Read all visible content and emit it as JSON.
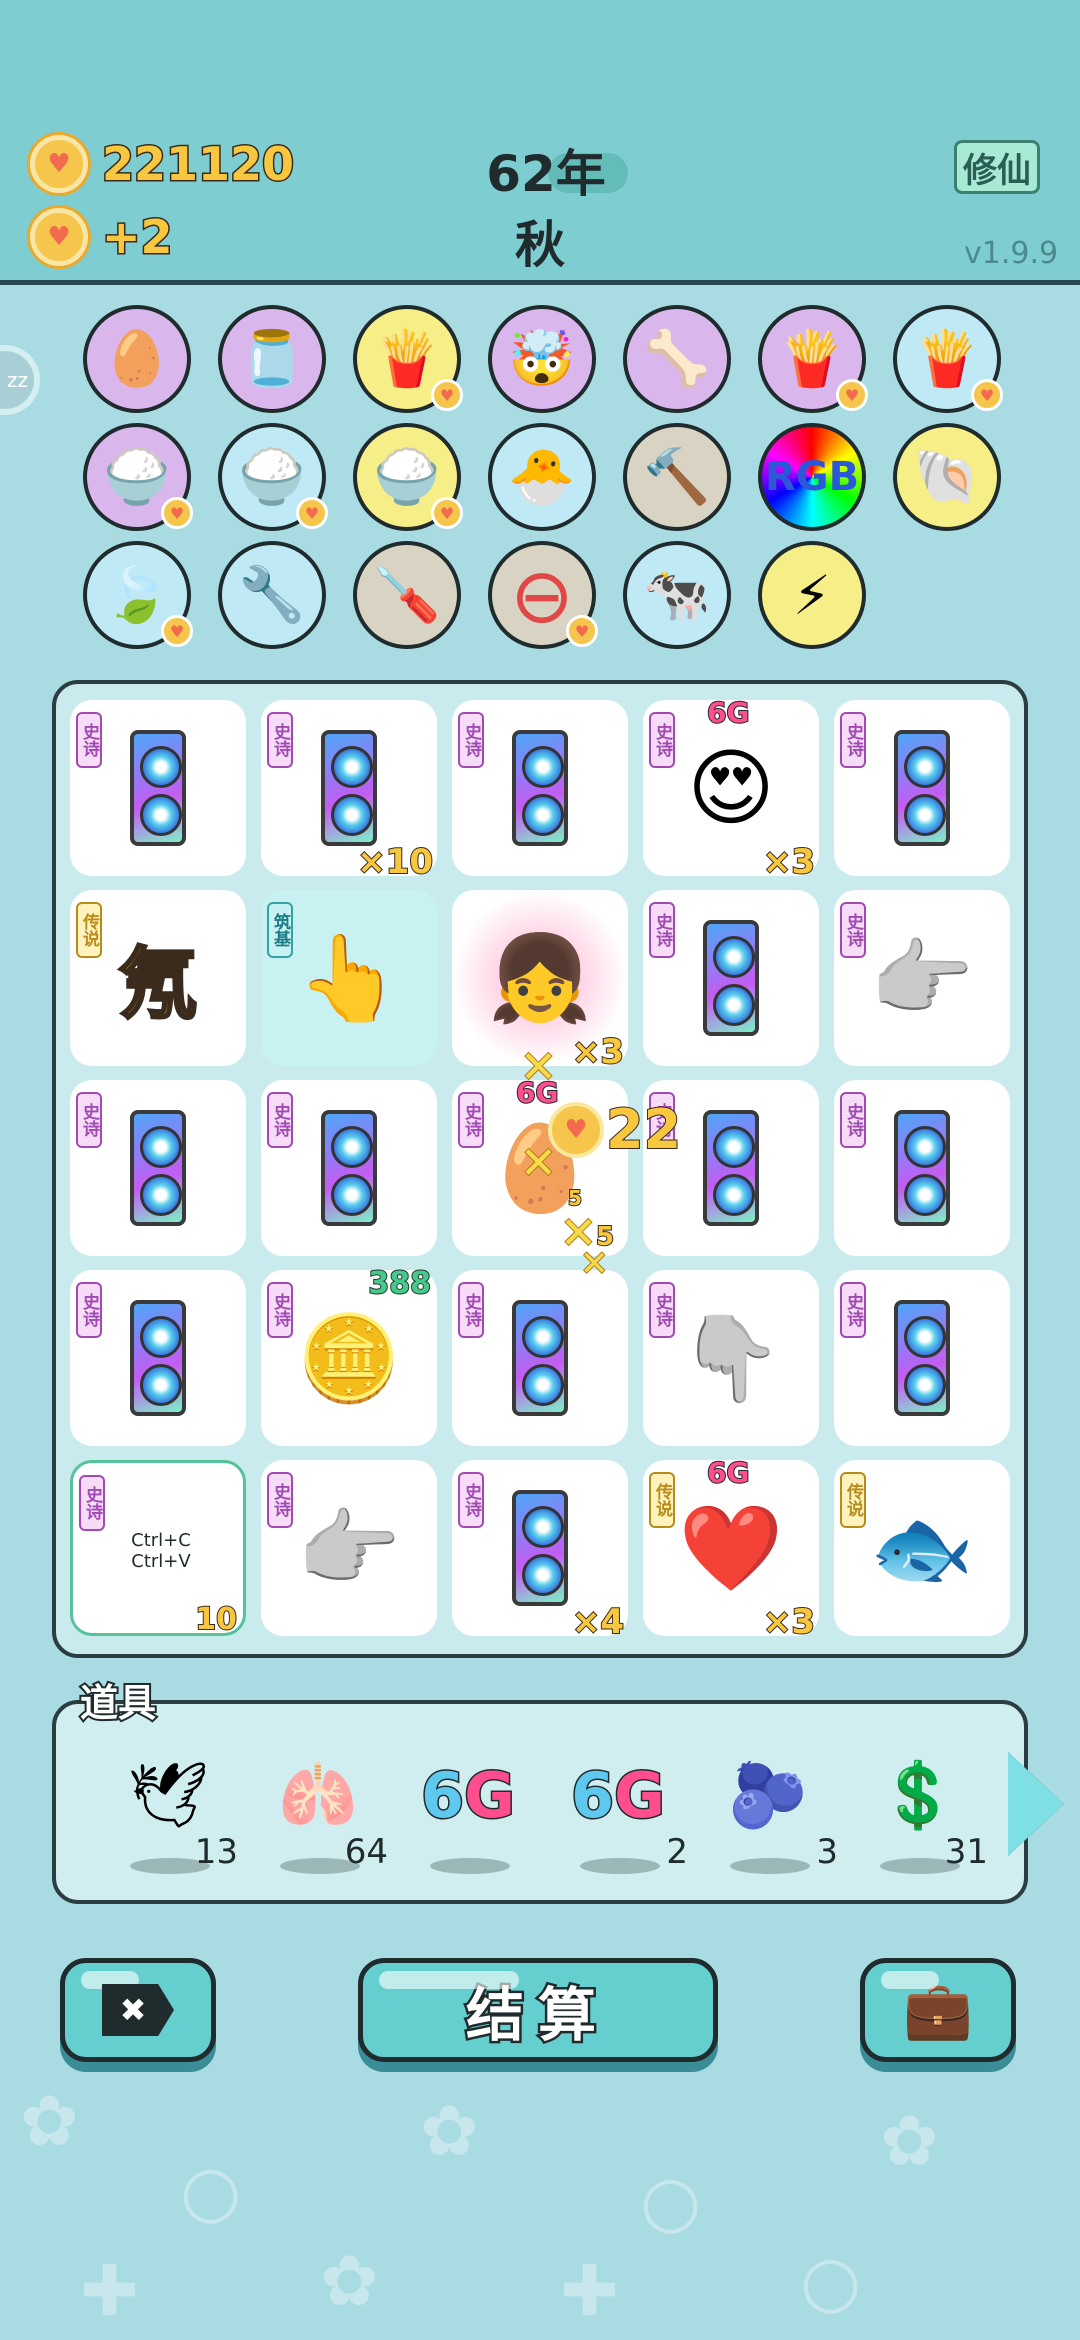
{
  "header": {
    "coins": "221120",
    "income": "+2",
    "year": "62年",
    "season": "秋",
    "mode_label": "修仙",
    "version": "v1.9.9",
    "side_bubble": "zz"
  },
  "items_row": [
    {
      "name": "egg-icon",
      "glyph": "🥚",
      "bg": "#d9b7ec",
      "heart": false
    },
    {
      "name": "jar-icon",
      "glyph": "🫙",
      "bg": "#d9b7ec",
      "heart": false
    },
    {
      "name": "fries-icon",
      "glyph": "🍟",
      "bg": "#f6ee86",
      "heart": true
    },
    {
      "name": "math-head-icon",
      "glyph": "🤯",
      "bg": "#d9b7ec",
      "heart": false
    },
    {
      "name": "dog-bowl-icon",
      "glyph": "🦴",
      "bg": "#d9b7ec",
      "heart": false
    },
    {
      "name": "fries-icon",
      "glyph": "🍟",
      "bg": "#d9b7ec",
      "heart": true
    },
    {
      "name": "fries-icon",
      "glyph": "🍟",
      "bg": "#bfe9f5",
      "heart": true
    },
    {
      "name": "rice-bowl-icon",
      "glyph": "🍚",
      "bg": "#d9b7ec",
      "heart": true
    },
    {
      "name": "rice-bowl-icon",
      "glyph": "🍚",
      "bg": "#bfe9f5",
      "heart": true
    },
    {
      "name": "rice-bowl-icon",
      "glyph": "🍚",
      "bg": "#f6ee86",
      "heart": true
    },
    {
      "name": "chick-egg-icon",
      "glyph": "🐣",
      "bg": "#bfe9f5",
      "heart": false
    },
    {
      "name": "hammer-icon",
      "glyph": "🔨",
      "bg": "#d8d3c2",
      "heart": false
    },
    {
      "name": "rgb-icon",
      "glyph": "RGB",
      "bg": "conic-gradient(red,yellow,lime,cyan,blue,magenta,red)",
      "heart": false
    },
    {
      "name": "shell-icon",
      "glyph": "🐚",
      "bg": "#f6ee86",
      "heart": false
    },
    {
      "name": "leaf-icon",
      "glyph": "🍃",
      "bg": "#bfe9f5",
      "heart": true
    },
    {
      "name": "shield-wrench-icon",
      "glyph": "🔧",
      "bg": "#bfe9f5",
      "heart": false
    },
    {
      "name": "screwdriver-icon",
      "glyph": "🪛",
      "bg": "#d8d3c2",
      "heart": false
    },
    {
      "name": "minus-circle-icon",
      "glyph": "⊖",
      "bg": "#d8d3c2",
      "heart": true
    },
    {
      "name": "cow-pair-icon",
      "glyph": "🐄",
      "bg": "#bfe9f5",
      "heart": false
    },
    {
      "name": "lightning-icon",
      "glyph": "⚡",
      "bg": "#f6ee86",
      "heart": false
    }
  ],
  "board": [
    {
      "tag": "史诗",
      "type": "epic",
      "item": "gpu"
    },
    {
      "tag": "史诗",
      "type": "epic",
      "item": "gpu",
      "mult": "×10"
    },
    {
      "tag": "史诗",
      "type": "epic",
      "item": "gpu"
    },
    {
      "tag": "史诗",
      "type": "epic",
      "item": "king-face",
      "glyph": "😍",
      "mult": "×3",
      "top": "6G"
    },
    {
      "tag": "史诗",
      "type": "epic",
      "item": "gpu"
    },
    {
      "tag": "传说",
      "type": "legend",
      "item": "neon-char",
      "glyph": "氖"
    },
    {
      "tag": "筑基",
      "type": "found",
      "item": "pointer-hand",
      "glyph": "👆",
      "hl": true
    },
    {
      "tag": "",
      "type": "",
      "item": "heart-girl",
      "glyph": "👧",
      "mult": "×3"
    },
    {
      "tag": "史诗",
      "type": "epic",
      "item": "gpu"
    },
    {
      "tag": "史诗",
      "type": "epic",
      "item": "gray-hand",
      "glyph": "👉"
    },
    {
      "tag": "史诗",
      "type": "epic",
      "item": "gpu"
    },
    {
      "tag": "史诗",
      "type": "epic",
      "item": "gpu"
    },
    {
      "tag": "史诗",
      "type": "epic",
      "item": "face-coin",
      "glyph": "🥚",
      "top": "6G"
    },
    {
      "tag": "史诗",
      "type": "epic",
      "item": "gpu"
    },
    {
      "tag": "史诗",
      "type": "epic",
      "item": "gpu"
    },
    {
      "tag": "史诗",
      "type": "epic",
      "item": "gpu"
    },
    {
      "tag": "史诗",
      "type": "epic",
      "item": "pie-coin",
      "glyph": "🪙",
      "green": "388"
    },
    {
      "tag": "史诗",
      "type": "epic",
      "item": "gpu"
    },
    {
      "tag": "史诗",
      "type": "epic",
      "item": "gray-hand",
      "glyph": "👇"
    },
    {
      "tag": "史诗",
      "type": "epic",
      "item": "gpu"
    },
    {
      "tag": "史诗",
      "type": "epic",
      "item": "copy-paste",
      "glyph": "Ctrl+C Ctrl+V",
      "cnt": "10",
      "sel": true
    },
    {
      "tag": "史诗",
      "type": "epic",
      "item": "gray-hand",
      "glyph": "👉"
    },
    {
      "tag": "史诗",
      "type": "epic",
      "item": "gpu",
      "mult": "×4"
    },
    {
      "tag": "传说",
      "type": "legend",
      "item": "crown-heart",
      "glyph": "❤️",
      "mult": "×3",
      "top": "6G"
    },
    {
      "tag": "传说",
      "type": "legend",
      "item": "koi",
      "glyph": "🐟"
    }
  ],
  "effects": {
    "coin_gain": "22",
    "small_cnt": "5"
  },
  "props_title": "道具",
  "props": [
    {
      "name": "pigeon-icon",
      "glyph": "🕊",
      "count": "13"
    },
    {
      "name": "liver-icon",
      "glyph": "🫁",
      "count": "64"
    },
    {
      "name": "6g-icon",
      "glyph": "6G",
      "count": ""
    },
    {
      "name": "6g-icon",
      "glyph": "6G",
      "count": "2"
    },
    {
      "name": "blueberry-icon",
      "glyph": "🫐",
      "count": "3"
    },
    {
      "name": "coin-icon",
      "glyph": "💲",
      "count": "31"
    }
  ],
  "buttons": {
    "settle": "结算",
    "close_glyph": "✖",
    "bag_glyph": "💼"
  }
}
